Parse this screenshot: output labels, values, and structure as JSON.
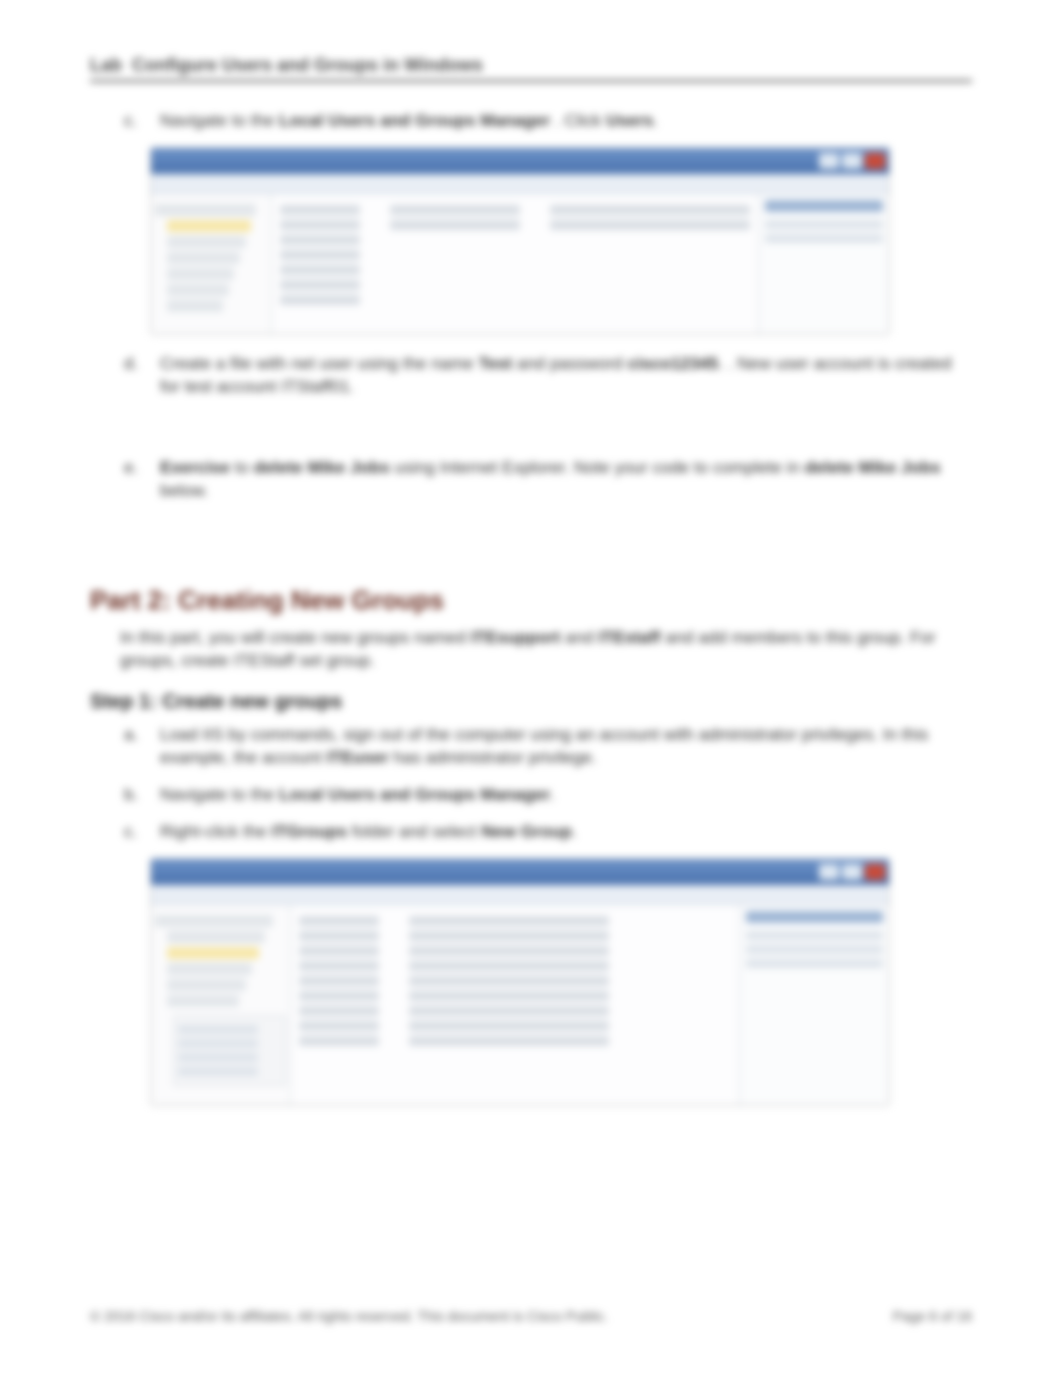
{
  "header": {
    "lab": "Lab",
    "title": "Configure Users and Groups in Windows"
  },
  "items": {
    "c": {
      "letter": "c.",
      "text_1": "Navigate to the ",
      "bold_1": "Local Users and Groups Manager",
      "text_2": ". Click ",
      "bold_2": "Users"
    },
    "d": {
      "letter": "d.",
      "text_1": "Create a file with net user using the name ",
      "bold_1": "Test",
      "text_2": " and password ",
      "bold_2": "cisco12345",
      "text_3": ". New user account is created for test account ITStaff01."
    },
    "e": {
      "letter": "e.",
      "bold_1": "Exercise",
      "text_1": " to ",
      "bold_2": "delete Mike Jobs",
      "text_2": " using Internet Explorer. Note your code to complete in ",
      "bold_3": "delete Mike Jobs",
      "text_3": " below."
    }
  },
  "part2": {
    "heading": "Part 2: Creating New Groups",
    "intro_1": "In this part, you will create new groups named ",
    "intro_b1": "ITEsupport",
    "intro_2": " and ",
    "intro_b2": "ITEstaff",
    "intro_3": " and add members to this group. For groups, create ITEStaff set group."
  },
  "step1": {
    "heading": "Step 1: Create new groups",
    "a": {
      "letter": "a.",
      "text_1": "Load IIS by commands, sign out of the computer using an account with administrator privileges. In this example, the account ",
      "bold_1": "ITEuser",
      "text_2": " has administrator privilege."
    },
    "b": {
      "letter": "b.",
      "text_1": "Navigate to the ",
      "bold_1": "Local Users and Groups Manager"
    },
    "c": {
      "letter": "c.",
      "text_1": "Right-click the ",
      "bold_1": "ITGroups",
      "text_2": " folder and select ",
      "bold_2": "New Group"
    }
  },
  "footer": {
    "copyright": "© 2016 Cisco and/or its affiliates. All rights reserved. This document is Cisco Public.",
    "page": "Page 6 of 16"
  }
}
